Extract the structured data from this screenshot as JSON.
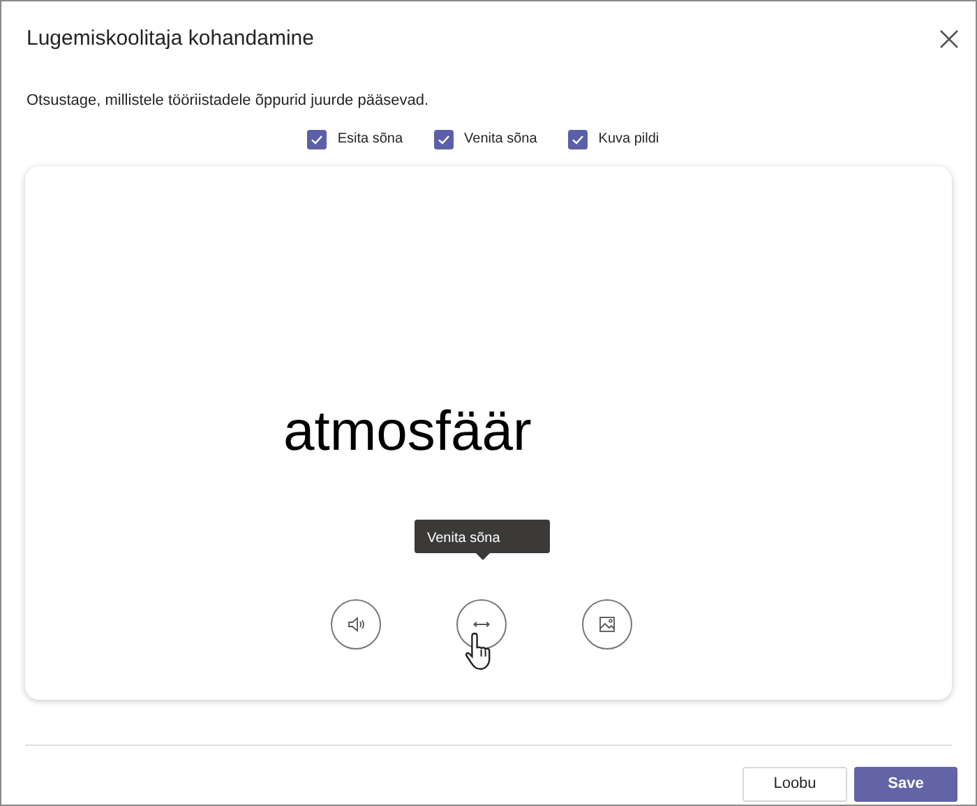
{
  "dialog": {
    "title": "Lugemiskoolitaja kohandamine",
    "instruction": "Otsustage, millistele tööriistadele õppurid juurde pääsevad."
  },
  "options": [
    {
      "label": "Esita sõna",
      "checked": true
    },
    {
      "label": "Venita sõna",
      "checked": true
    },
    {
      "label": "Kuva pildi",
      "checked": true
    }
  ],
  "preview": {
    "word": "atmosfäär",
    "tools": [
      {
        "kind": "speaker"
      },
      {
        "kind": "stretch",
        "tooltip": "Venita sõna"
      },
      {
        "kind": "image"
      }
    ]
  },
  "buttons": [
    {
      "label": "Loobu",
      "kind": "secondary"
    },
    {
      "label": "Save",
      "kind": "primary"
    }
  ]
}
